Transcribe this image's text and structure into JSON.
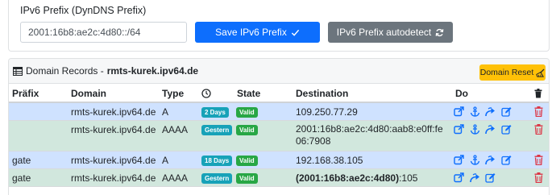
{
  "prefix_card": {
    "title": "IPv6 Prefix (DynDNS Prefix)",
    "input_value": "2001:16b8:ae2c:4d80::/64",
    "save_label": "Save IPv6 Prefix",
    "autodetect_label": "IPv6 Prefix autodetect"
  },
  "records_card": {
    "title_prefix": "Domain Records - ",
    "title_domain": "rmts-kurek.ipv64.de",
    "reset_label": "Domain Reset"
  },
  "table": {
    "headers": {
      "prefix": "Präfix",
      "domain": "Domain",
      "type": "Type",
      "state": "State",
      "destination": "Destination",
      "do": "Do"
    },
    "rows": [
      {
        "prefix": "",
        "domain": "rmts-kurek.ipv64.de",
        "type": "A",
        "age": "2 Days",
        "state": "Valid",
        "destination": "109.250.77.29",
        "dest_bold": "",
        "dest_rest": ""
      },
      {
        "prefix": "",
        "domain": "rmts-kurek.ipv64.de",
        "type": "AAAA",
        "age": "Gestern",
        "state": "Valid",
        "destination": "2001:16b8:ae2c:4d80:aab8:e0ff:fe06:7908",
        "dest_bold": "",
        "dest_rest": ""
      },
      {
        "prefix": "gate",
        "domain": "rmts-kurek.ipv64.de",
        "type": "A",
        "age": "18 Days",
        "state": "Valid",
        "destination": "192.168.38.105",
        "dest_bold": "",
        "dest_rest": ""
      },
      {
        "prefix": "gate",
        "domain": "rmts-kurek.ipv64.de",
        "type": "AAAA",
        "age": "Gestern",
        "state": "Valid",
        "destination": "",
        "dest_bold": "(2001:16b8:ae2c:4d80)",
        "dest_rest": ":105"
      }
    ]
  },
  "colors": {
    "primary": "#0d6efd",
    "secondary": "#6c757d",
    "warning": "#ffc107",
    "info": "#17a2b8",
    "success": "#28a745",
    "danger": "#dc3545",
    "row_blue": "#cfe2ff",
    "row_green": "#d1e7dd"
  },
  "icons": {
    "save": "check-icon",
    "autodetect": "refresh-icon",
    "reset": "broom-icon",
    "time_header": "clock-icon",
    "do_actions": [
      "external-link-icon",
      "anchor-icon",
      "share-icon",
      "edit-icon"
    ],
    "delete": "trash-icon",
    "title": "table-icon"
  }
}
